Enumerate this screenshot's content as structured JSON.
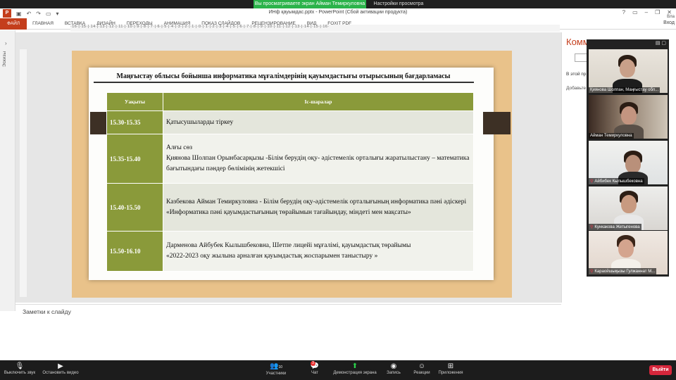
{
  "zoom_banner": {
    "sharing": "Вы просматриваете экран Айман Темиркуловна",
    "view_options": "Настройки просмотра ⌄"
  },
  "ppt": {
    "title": "ИНф қауымдас.pptx - PowerPoint (Сбой активации продукта)",
    "user": "Вла",
    "tabs": [
      "ФАЙЛ",
      "ГЛАВНАЯ",
      "ВСТАВКА",
      "ДИЗАЙН",
      "ПЕРЕХОДЫ",
      "АНИМАЦИЯ",
      "ПОКАЗ СЛАЙДОВ",
      "РЕЦЕНЗИРОВАНИЕ",
      "ВИД",
      "FOXIT PDF"
    ],
    "login": "Вход",
    "left_panel_label": "Эскизы",
    "ruler_text": "·16·|·15·|·14·|·13·|·12·|·11·|·10·|·9·|·8·|·7·|·6·|·5·|·4·|·3·|·2·|·1·|·0·|·1·|·2·|·3·|·4·|·5·|·6·|·7·|·8·|·9·|·10·|·11·|·12·|·13·|·14·|·15·|·16·",
    "notes_placeholder": "Заметки к слайду",
    "comments": {
      "header": "Комм",
      "line1": "В этой пр",
      "line2": "Добавьте"
    }
  },
  "slide": {
    "title": "Маңғыстау облысы бойынша информатика  мұғалімдерінің қауымдастығы отырысының бағдарламасы",
    "col_time": "Уақыты",
    "col_activity": "Іс-шаралар",
    "rows": [
      {
        "time": "15.30-15.35",
        "lines": [
          "Қатысушыларды тіркеу"
        ]
      },
      {
        "time": "15.35-15.40",
        "lines": [
          "Алғы сөз",
          "Қиянова Шолпан Орынбасарқызы  -Білім берудің оқу- әдістемелік орталығы жаратылыстану – математика  бағытындағы пәндер бөлімінің жетекшісі"
        ]
      },
      {
        "time": "15.40-15.50",
        "lines": [
          "Казбекова Айман Темиркуловна - Білім берудің оқу-әдістемелік орталығының информатика пәні әдіскері",
          " «Информатика пәні қауымдастығының төрайымын тағайындау,  міндеті мен мақсаты»"
        ]
      },
      {
        "time": "15.50-16.10",
        "lines": [
          "Дарменова Айбубек Кылышбековна, Шетпе лицейі мұғалімі, қауымдастық төрайымы",
          "  «2022-2023 оқу жылына арналған қауымдастық жоспарымен танысты​ру »"
        ]
      }
    ]
  },
  "gallery": {
    "participants": [
      {
        "name": "Қиянова Шолпан, Маңғыстау обл...",
        "muted": false
      },
      {
        "name": "Айман Темиркуловна",
        "muted": false
      },
      {
        "name": "Айбибек Кылышбековна",
        "muted": true
      },
      {
        "name": "Кункакова Жетыгенова",
        "muted": true
      },
      {
        "name": "Караойшықызы Гулжаннат М...",
        "muted": true
      }
    ]
  },
  "toolbar": {
    "mute": "Выключить звук",
    "video": "Остановить видео",
    "participants": "Участники",
    "participants_count": "10",
    "chat": "Чат",
    "chat_badge": "3",
    "share": "Демонстрация экрана",
    "record": "Запись",
    "reactions": "Реакции",
    "apps": "Приложения",
    "leave": "Выйти"
  }
}
